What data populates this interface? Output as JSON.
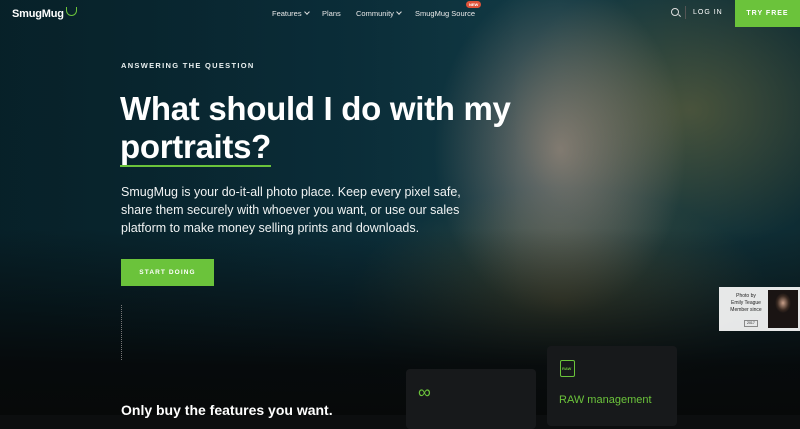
{
  "header": {
    "logo": "SmugMug",
    "nav": [
      {
        "label": "Features",
        "dropdown": true
      },
      {
        "label": "Plans",
        "dropdown": false
      },
      {
        "label": "Community",
        "dropdown": true
      },
      {
        "label": "SmugMug Source",
        "dropdown": false,
        "badge": "NEW"
      }
    ],
    "login": "LOG IN",
    "try_free": "TRY FREE"
  },
  "hero": {
    "eyebrow": "ANSWERING THE QUESTION",
    "headline_1": "What should I do with my",
    "headline_2": "portraits?",
    "body": "SmugMug is your do-it-all photo place. Keep every pixel safe, share them securely with whoever you want, or use our sales platform to make money selling prints and downloads.",
    "cta": "START DOING"
  },
  "photo_credit": {
    "lines": [
      "Photo by",
      "Emily Teague",
      "Member since"
    ],
    "chip": "2017"
  },
  "cards": {
    "infinity_icon": "infinity-icon",
    "raw_icon_label": "RAW",
    "raw_title": "RAW management"
  },
  "section": {
    "heading": "Only buy the features you want."
  },
  "colors": {
    "accent": "#6bc33b",
    "badge": "#e0533a"
  }
}
